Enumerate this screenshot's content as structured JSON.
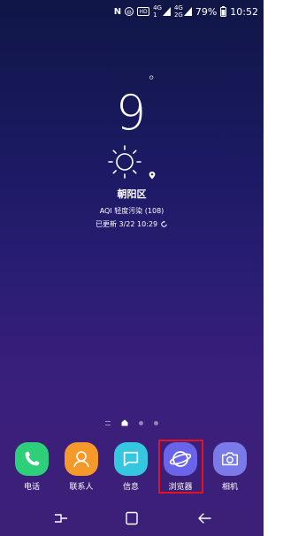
{
  "status_bar": {
    "nfc": "N",
    "hd": "HD",
    "net1_top": "4G",
    "net1_bottom": "1",
    "net2_top": "4G",
    "net2_bottom": "2G",
    "battery": "79%",
    "time": "10:52"
  },
  "weather": {
    "temperature": "9",
    "degree": "°",
    "city": "朝阳区",
    "aqi": "AQI 轻度污染 (108)",
    "updated": "已更新 3/22 10:29"
  },
  "dock": {
    "apps": [
      {
        "label": "电话",
        "color": "#2ecf7a"
      },
      {
        "label": "联系人",
        "color": "#f59a2a"
      },
      {
        "label": "信息",
        "color": "#35c7df"
      },
      {
        "label": "浏览器",
        "color": "#6a64ea"
      },
      {
        "label": "相机",
        "color": "#7a7be8"
      }
    ]
  },
  "colors": {
    "highlight": "#e3141b"
  }
}
